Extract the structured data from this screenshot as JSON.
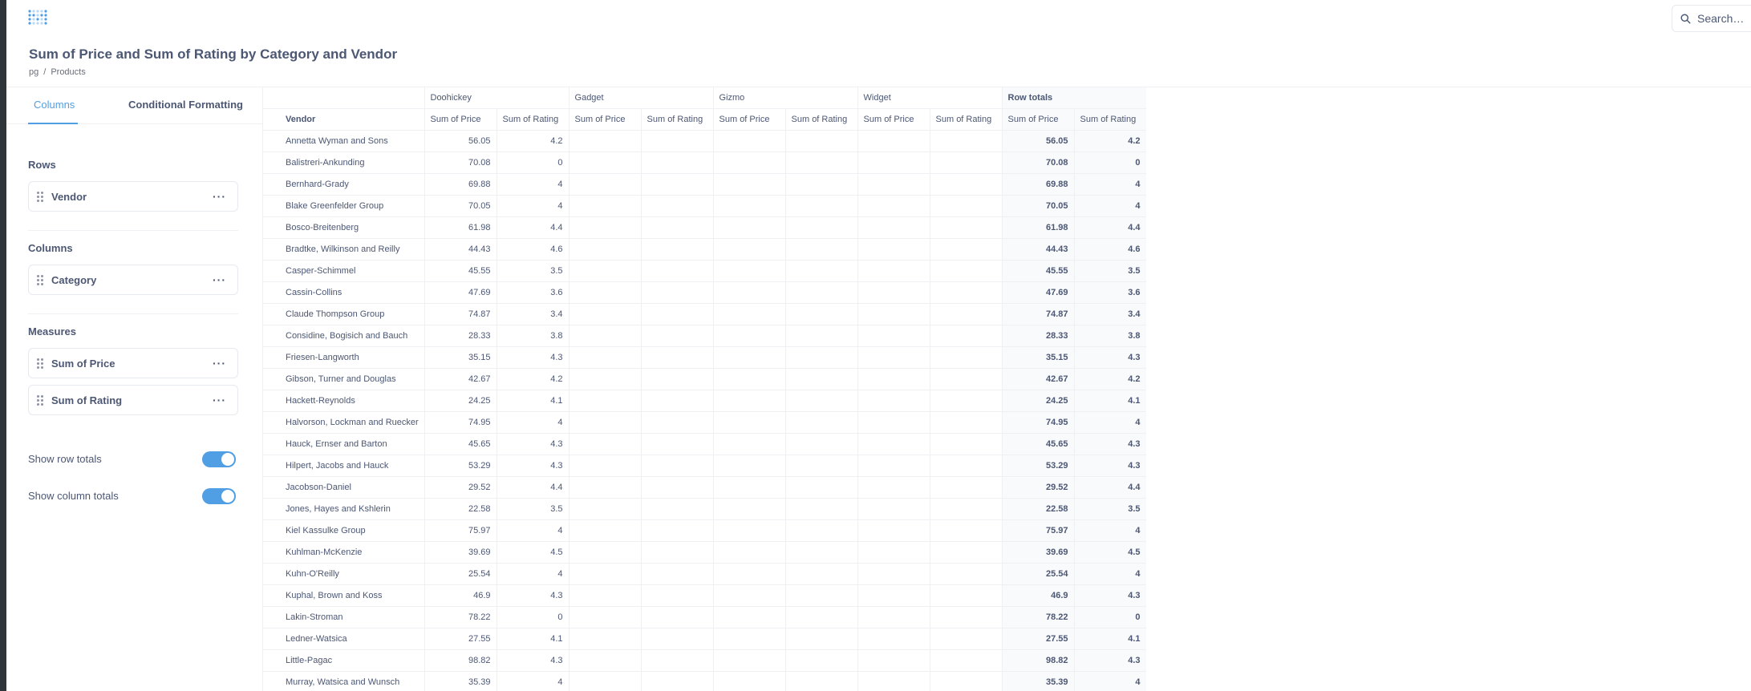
{
  "header": {
    "logo": "metabase-logo-icon",
    "search_placeholder": "Search…"
  },
  "question": {
    "title": "Sum of Price and Sum of Rating by Category and Vendor",
    "breadcrumb": [
      "pg",
      "Products"
    ],
    "breadcrumb_sep": "/"
  },
  "sidebar": {
    "tabs": [
      {
        "label": "Columns",
        "active": true
      },
      {
        "label": "Conditional Formatting",
        "active": false
      }
    ],
    "sections": {
      "rows": {
        "label": "Rows",
        "items": [
          "Vendor"
        ]
      },
      "columns": {
        "label": "Columns",
        "items": [
          "Category"
        ]
      },
      "measures": {
        "label": "Measures",
        "items": [
          "Sum of Price",
          "Sum of Rating"
        ]
      }
    },
    "more_glyph": "···",
    "toggles": [
      {
        "label": "Show row totals",
        "on": true
      },
      {
        "label": "Show column totals",
        "on": true
      }
    ]
  },
  "colors": {
    "accent": "#509ee3",
    "text": "#4c5773",
    "border": "#eef0f3"
  },
  "table": {
    "category_headers": [
      "Doohickey",
      "Gadget",
      "Gizmo",
      "Widget",
      "Row totals"
    ],
    "row_header": "Vendor",
    "sub_headers": [
      "Sum of Price",
      "Sum of Rating"
    ],
    "rows": [
      {
        "vendor": "Annetta Wyman and Sons",
        "price": "56.05",
        "rating": "4.2"
      },
      {
        "vendor": "Balistreri-Ankunding",
        "price": "70.08",
        "rating": "0"
      },
      {
        "vendor": "Bernhard-Grady",
        "price": "69.88",
        "rating": "4"
      },
      {
        "vendor": "Blake Greenfelder Group",
        "price": "70.05",
        "rating": "4"
      },
      {
        "vendor": "Bosco-Breitenberg",
        "price": "61.98",
        "rating": "4.4"
      },
      {
        "vendor": "Bradtke, Wilkinson and Reilly",
        "price": "44.43",
        "rating": "4.6"
      },
      {
        "vendor": "Casper-Schimmel",
        "price": "45.55",
        "rating": "3.5"
      },
      {
        "vendor": "Cassin-Collins",
        "price": "47.69",
        "rating": "3.6"
      },
      {
        "vendor": "Claude Thompson Group",
        "price": "74.87",
        "rating": "3.4"
      },
      {
        "vendor": "Considine, Bogisich and Bauch",
        "price": "28.33",
        "rating": "3.8"
      },
      {
        "vendor": "Friesen-Langworth",
        "price": "35.15",
        "rating": "4.3"
      },
      {
        "vendor": "Gibson, Turner and Douglas",
        "price": "42.67",
        "rating": "4.2"
      },
      {
        "vendor": "Hackett-Reynolds",
        "price": "24.25",
        "rating": "4.1"
      },
      {
        "vendor": "Halvorson, Lockman and Ruecker",
        "price": "74.95",
        "rating": "4"
      },
      {
        "vendor": "Hauck, Ernser and Barton",
        "price": "45.65",
        "rating": "4.3"
      },
      {
        "vendor": "Hilpert, Jacobs and Hauck",
        "price": "53.29",
        "rating": "4.3"
      },
      {
        "vendor": "Jacobson-Daniel",
        "price": "29.52",
        "rating": "4.4"
      },
      {
        "vendor": "Jones, Hayes and Kshlerin",
        "price": "22.58",
        "rating": "3.5"
      },
      {
        "vendor": "Kiel Kassulke Group",
        "price": "75.97",
        "rating": "4"
      },
      {
        "vendor": "Kuhlman-McKenzie",
        "price": "39.69",
        "rating": "4.5"
      },
      {
        "vendor": "Kuhn-O'Reilly",
        "price": "25.54",
        "rating": "4"
      },
      {
        "vendor": "Kuphal, Brown and Koss",
        "price": "46.9",
        "rating": "4.3"
      },
      {
        "vendor": "Lakin-Stroman",
        "price": "78.22",
        "rating": "0"
      },
      {
        "vendor": "Ledner-Watsica",
        "price": "27.55",
        "rating": "4.1"
      },
      {
        "vendor": "Little-Pagac",
        "price": "98.82",
        "rating": "4.3"
      },
      {
        "vendor": "Murray, Watsica and Wunsch",
        "price": "35.39",
        "rating": "4"
      }
    ]
  }
}
